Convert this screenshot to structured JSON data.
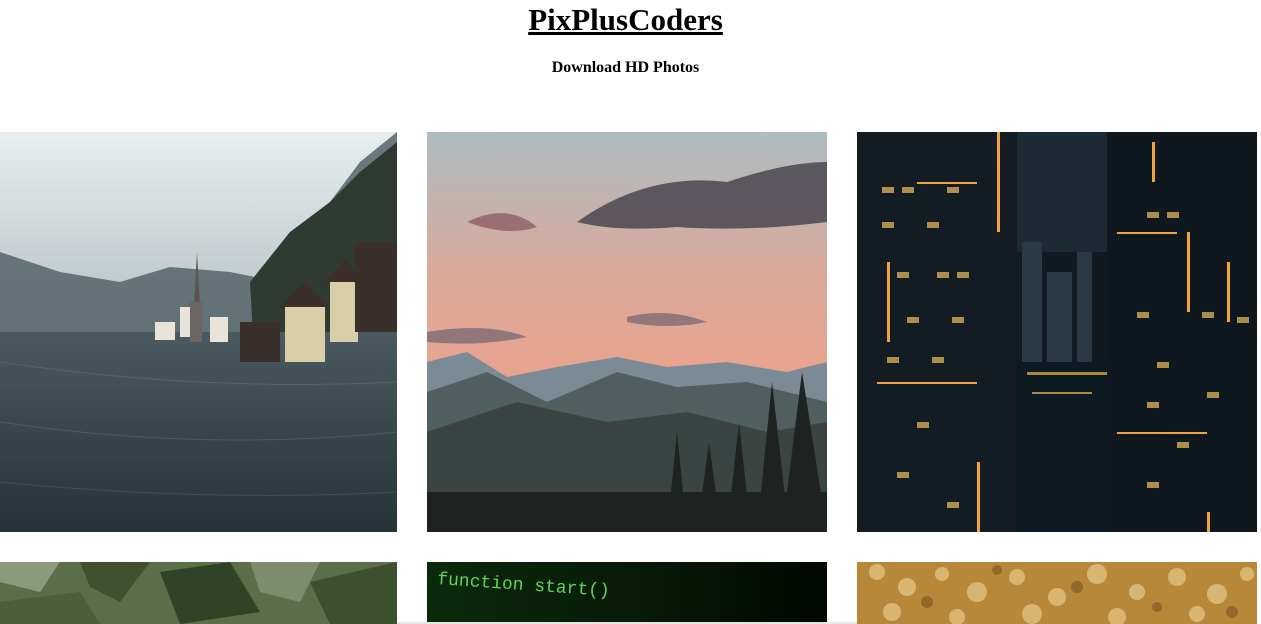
{
  "header": {
    "title": "PixPlusCoders",
    "subtitle": "Download HD Photos"
  },
  "gallery": {
    "photos": [
      {
        "subject": "lakeside-village",
        "row": 1,
        "col": 1
      },
      {
        "subject": "mountain-sunset",
        "row": 1,
        "col": 2
      },
      {
        "subject": "city-night",
        "row": 1,
        "col": 3
      },
      {
        "subject": "green-foliage",
        "row": 2,
        "col": 1
      },
      {
        "subject": "code-screen",
        "row": 2,
        "col": 2,
        "code_text": "function start()"
      },
      {
        "subject": "golden-bokeh",
        "row": 2,
        "col": 3
      }
    ]
  },
  "colors": {
    "background": "#ffffff",
    "text": "#000000"
  }
}
